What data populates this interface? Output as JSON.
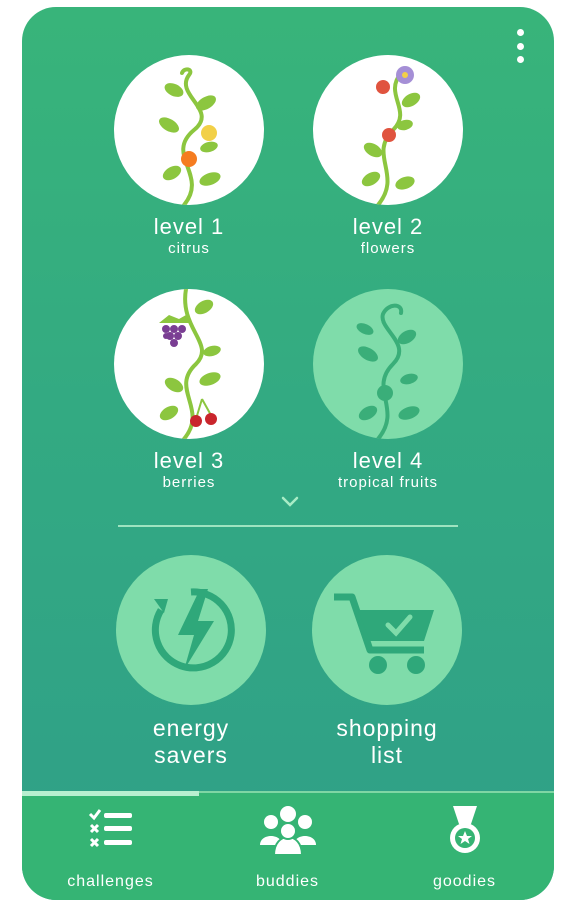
{
  "levels": [
    {
      "title": "level 1",
      "subtitle": "citrus"
    },
    {
      "title": "level 2",
      "subtitle": "flowers"
    },
    {
      "title": "level 3",
      "subtitle": "berries"
    },
    {
      "title": "level 4",
      "subtitle": "tropical fruits"
    }
  ],
  "tools": [
    {
      "line1": "energy",
      "line2": "savers",
      "icon": "energy-bolt-icon"
    },
    {
      "line1": "shopping",
      "line2": "list",
      "icon": "shopping-cart-icon"
    }
  ],
  "tabs": [
    {
      "label": "challenges",
      "icon": "checklist-icon"
    },
    {
      "label": "buddies",
      "icon": "people-icon"
    },
    {
      "label": "goodies",
      "icon": "medal-icon"
    }
  ],
  "colors": {
    "primary_green": "#38b47a",
    "light_green": "#7fdcaa",
    "leaf": "#8cc63f",
    "orange": "#f57c20",
    "grape": "#7a3e93",
    "cherry": "#c9252c"
  }
}
